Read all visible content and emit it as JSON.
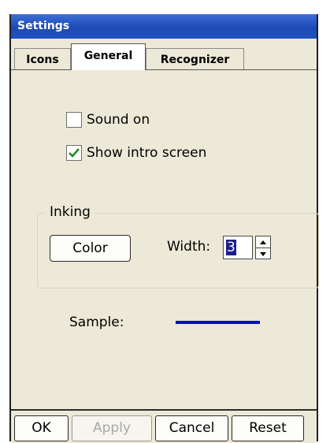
{
  "window": {
    "title": "Settings"
  },
  "tabs": [
    {
      "label": "Icons",
      "active": false
    },
    {
      "label": "General",
      "active": true
    },
    {
      "label": "Recognizer",
      "active": false
    }
  ],
  "general": {
    "sound_on": {
      "label": "Sound on",
      "checked": false
    },
    "show_intro": {
      "label": "Show intro screen",
      "checked": true
    },
    "inking": {
      "group_label": "Inking",
      "color_button": "Color",
      "width_label": "Width:",
      "width_value": "3"
    },
    "sample": {
      "label": "Sample:",
      "line_color": "#0b0bcf"
    }
  },
  "bottom_buttons": {
    "ok": "OK",
    "apply": "Apply",
    "cancel": "Cancel",
    "reset": "Reset"
  },
  "colors": {
    "titlebar": "#2151c4",
    "panel_bg": "#ece9d8",
    "checkmark": "#1f8f1f"
  }
}
